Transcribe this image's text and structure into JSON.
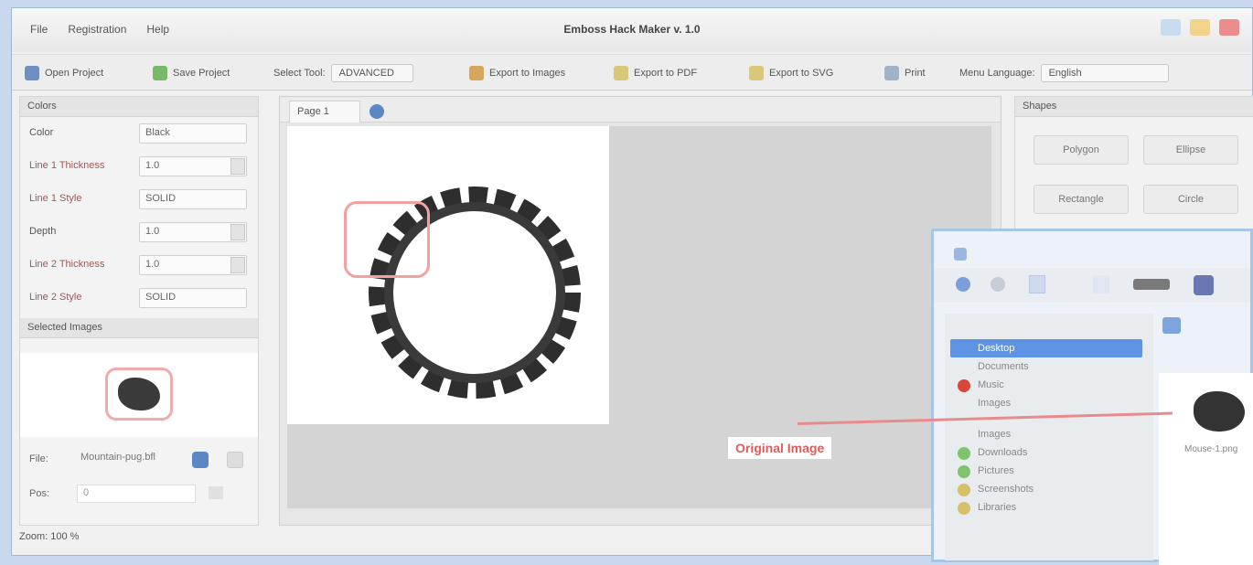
{
  "app": {
    "title": "Emboss Hack Maker v. 1.0",
    "menu": [
      "File",
      "Registration",
      "Help"
    ]
  },
  "toolbar": {
    "open_label": "Open Project",
    "save_label": "Save Project",
    "select_label": "Select Tool:",
    "select_value": "ADVANCED",
    "export_images_label": "Export to Images",
    "export_pdf_label": "Export to PDF",
    "export_svg_label": "Export to SVG",
    "print_label": "Print",
    "language_label": "Menu Language:",
    "language_value": "English"
  },
  "left_panel": {
    "header": "Colors",
    "rows": [
      {
        "label": "Color",
        "value": "Black",
        "style": "plain"
      },
      {
        "label": "Line 1 Thickness",
        "value": "1.0",
        "style": "red"
      },
      {
        "label": "Line 1 Style",
        "value": "SOLID",
        "style": "red"
      },
      {
        "label": "Depth",
        "value": "1.0",
        "style": "plain"
      },
      {
        "label": "Line 2 Thickness",
        "value": "1.0",
        "style": "red"
      },
      {
        "label": "Line 2 Style",
        "value": "SOLID",
        "style": "red"
      }
    ],
    "preview_header": "Selected Images",
    "file_label": "File:",
    "file_value": "Mountain-pug.bfl",
    "pos_label": "Pos:",
    "pos_value": "0"
  },
  "canvas": {
    "tab_label": "Page 1"
  },
  "right_panel": {
    "header": "Shapes",
    "buttons": [
      "Polygon",
      "Ellipse",
      "Rectangle",
      "Circle"
    ]
  },
  "sub_window": {
    "nav_items": [
      "Desktop",
      "Documents",
      "Music",
      "Images",
      "Images",
      "Downloads",
      "Pictures",
      "Screenshots",
      "Libraries"
    ],
    "file_caption": "Mouse-1.png"
  },
  "annotation": {
    "callout_text": "Original Image"
  },
  "status": {
    "zoom": "Zoom: 100 %"
  },
  "colors": {
    "accent": "#5b87c5",
    "highlight": "#f2a0a0"
  }
}
